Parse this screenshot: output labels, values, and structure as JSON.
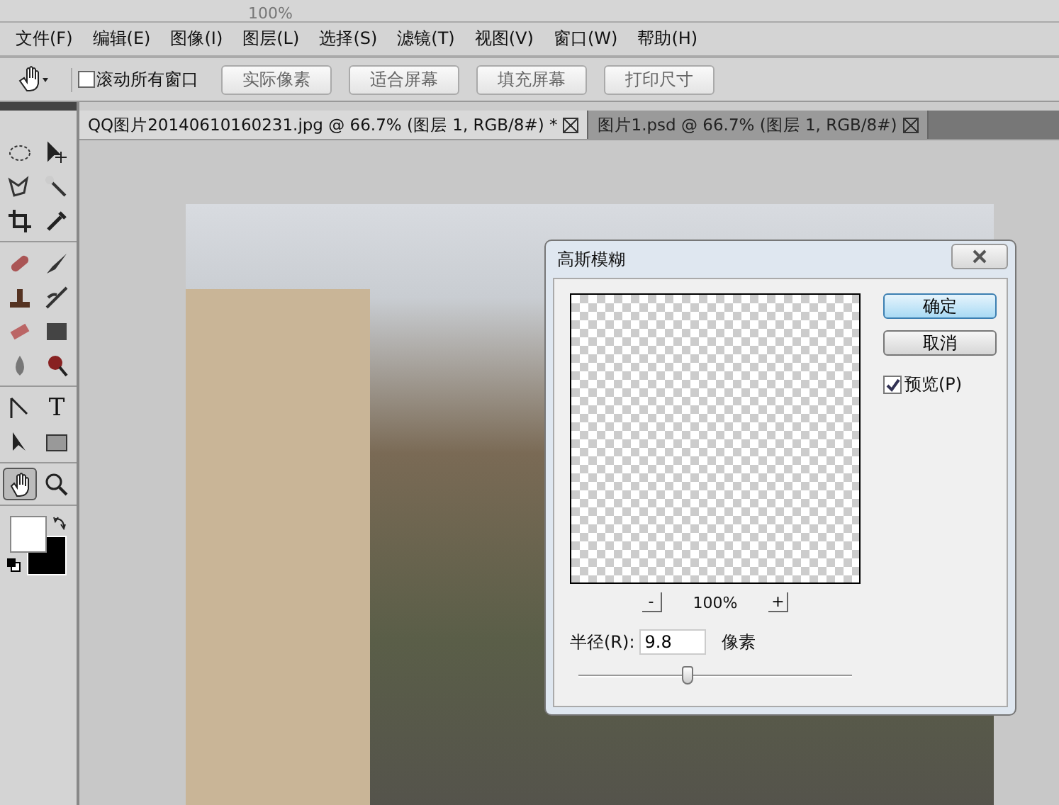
{
  "top_bar": {
    "zoom": "100%"
  },
  "menu": [
    "文件(F)",
    "编辑(E)",
    "图像(I)",
    "图层(L)",
    "选择(S)",
    "滤镜(T)",
    "视图(V)",
    "窗口(W)",
    "帮助(H)"
  ],
  "options_bar": {
    "scroll_all": {
      "label": "滚动所有窗口",
      "checked": false
    },
    "buttons": [
      "实际像素",
      "适合屏幕",
      "填充屏幕",
      "打印尺寸"
    ]
  },
  "document_tabs": [
    {
      "title": "QQ图片20140610160231.jpg @ 66.7% (图层 1, RGB/8#) *",
      "selected": true
    },
    {
      "title": "图片1.psd @ 66.7% (图层 1, RGB/8#)",
      "selected": false
    }
  ],
  "tools": [
    {
      "kind": "marquee",
      "selected": false
    },
    {
      "kind": "move",
      "selected": false
    },
    {
      "kind": "lasso",
      "selected": false
    },
    {
      "kind": "wand",
      "selected": false
    },
    {
      "kind": "crop",
      "selected": false
    },
    {
      "kind": "eyedropper",
      "selected": false
    },
    {
      "kind": "bandage",
      "selected": false
    },
    {
      "kind": "brush",
      "selected": false
    },
    {
      "kind": "stamp",
      "selected": false
    },
    {
      "kind": "history",
      "selected": false
    },
    {
      "kind": "eraser",
      "selected": false
    },
    {
      "kind": "gradient",
      "selected": false
    },
    {
      "kind": "drop",
      "selected": false
    },
    {
      "kind": "dodge",
      "selected": false
    },
    {
      "kind": "pen",
      "selected": false
    },
    {
      "kind": "type",
      "label": "T",
      "selected": false
    },
    {
      "kind": "arrow",
      "selected": false
    },
    {
      "kind": "rect",
      "selected": false
    },
    {
      "kind": "hand",
      "selected": true
    },
    {
      "kind": "zoom",
      "selected": false
    }
  ],
  "dialog": {
    "title": "高斯模糊",
    "ok": "确定",
    "cancel": "取消",
    "preview": {
      "label": "预览(P)",
      "checked": true
    },
    "zoom_out": "-",
    "zoom": "100%",
    "zoom_in": "+",
    "radius_label": "半径(R):",
    "radius": "9.8",
    "unit": "像素",
    "level": 0.4
  }
}
